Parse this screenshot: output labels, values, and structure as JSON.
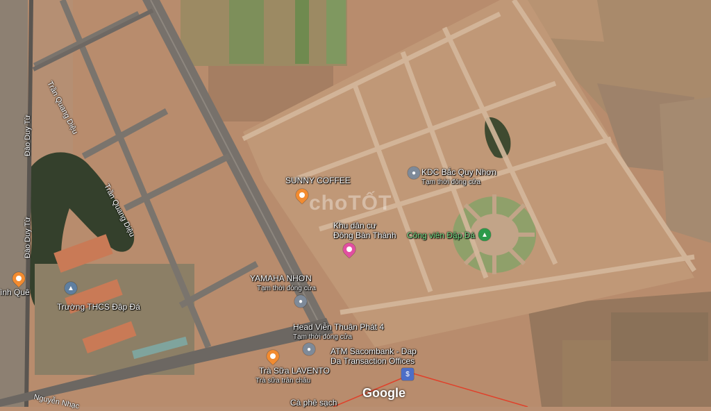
{
  "map": {
    "watermark": "choTỐT",
    "logo": "Google",
    "streets": {
      "dao_duy_tu_1": "Đào Duy Từ",
      "dao_duy_tu_2": "Đào Duy Từ",
      "tran_quang_dieu_1": "Trần Quang Diệu",
      "tran_quang_dieu_2": "Trần Quang Diệu",
      "nguyen_nhac": "Nguyễn Nhạc"
    },
    "places": {
      "sunny_coffee": "SUNNY COFFEE",
      "kdc_bac_quy_nhon": "KDC Bắc Quy Nhơn",
      "kdc_bac_quy_nhon_status": "Tạm thời đóng cửa",
      "khu_dan_cu_1": "Khu dân cư",
      "khu_dan_cu_2": "Đông Bàn Thành",
      "cong_vien": "Công viên Đập Đá",
      "yamaha": "YAMAHA NHƠN",
      "yamaha_status": "Tạm thời đóng cửa",
      "truong_thcs": "Trường THCS Đập Đá",
      "tinh_que": "ình Quê",
      "head_vien": "Head Viễn Thuận Phát 4",
      "head_vien_status": "Tạm thời đóng cửa",
      "atm_line1": "ATM Sacombank - Dap",
      "atm_line2": "Da Transaction Offices",
      "tra_sua": "Trà Sữa LAVENTO",
      "tra_sua_sub": "Trà sữa trân châu",
      "ca_phe": "Cà phê sạch"
    },
    "colors": {
      "food_pin": "#f28b30",
      "lodging_pin": "#e24fa1",
      "park_pin": "#2c9a4a",
      "service_pin": "#7e8a99",
      "school_pin": "#5f7fa0",
      "bank_pin": "#4c6ec7"
    }
  }
}
